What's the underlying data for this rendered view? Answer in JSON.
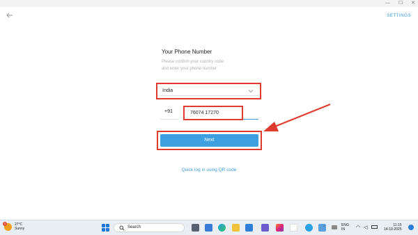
{
  "window": {
    "settings_label": "SETTINGS"
  },
  "form": {
    "title": "Your Phone Number",
    "subtitle_line1": "Please confirm your country code",
    "subtitle_line2": "and enter your phone number",
    "country_value": "India",
    "country_code": "+91",
    "phone_value": "76074 17270",
    "next_label": "Next",
    "qr_link": "Quick log in using QR code"
  },
  "taskbar": {
    "weather_temp": "27°C",
    "weather_cond": "Sunny",
    "weather_badge": "1",
    "search_label": "Search",
    "lang_line1": "ENG",
    "lang_line2": "IN",
    "time": "11:15",
    "date": "14-10-2025",
    "icons": [
      "widgets-icon",
      "task-view-icon",
      "edge-icon",
      "file-explorer-icon",
      "mail-icon",
      "store-icon",
      "zed-icon",
      "instagram-icon",
      "chrome-icon",
      "telegram-icon"
    ]
  },
  "colors": {
    "accent_blue": "#3d9ee0",
    "highlight_red": "#e03b2f"
  }
}
